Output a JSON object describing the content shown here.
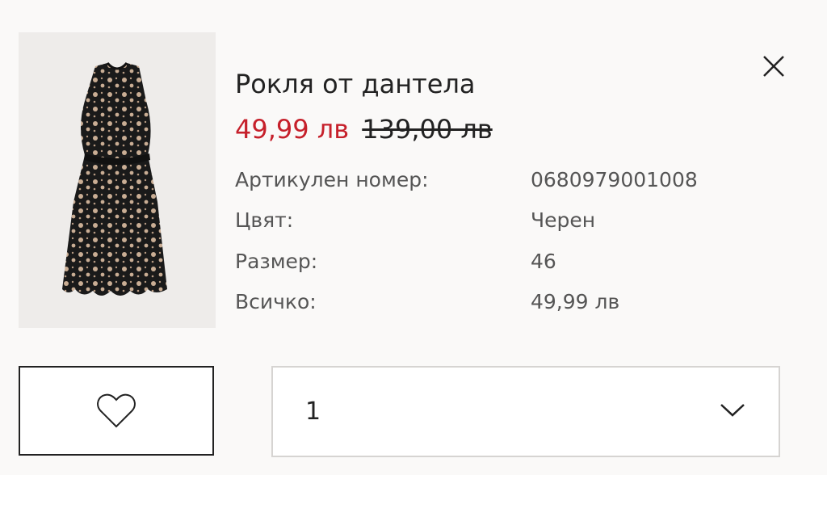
{
  "product": {
    "title": "Рокля от дантела",
    "price_sale": "49,99 лв",
    "price_old": "139,00 лв",
    "image_icon": "dress-image"
  },
  "details": [
    {
      "label": "Артикулен номер:",
      "value": "0680979001008"
    },
    {
      "label": "Цвят:",
      "value": "Черен"
    },
    {
      "label": "Размер:",
      "value": "46"
    },
    {
      "label": "Всичко:",
      "value": "49,99 лв"
    }
  ],
  "quantity": {
    "selected": "1"
  },
  "icons": {
    "close": "close-icon",
    "wishlist": "heart-icon",
    "dropdown": "chevron-down-icon"
  },
  "colors": {
    "sale": "#c6202b",
    "text": "#222222",
    "muted": "#555555",
    "card_bg": "#faf9f8"
  }
}
